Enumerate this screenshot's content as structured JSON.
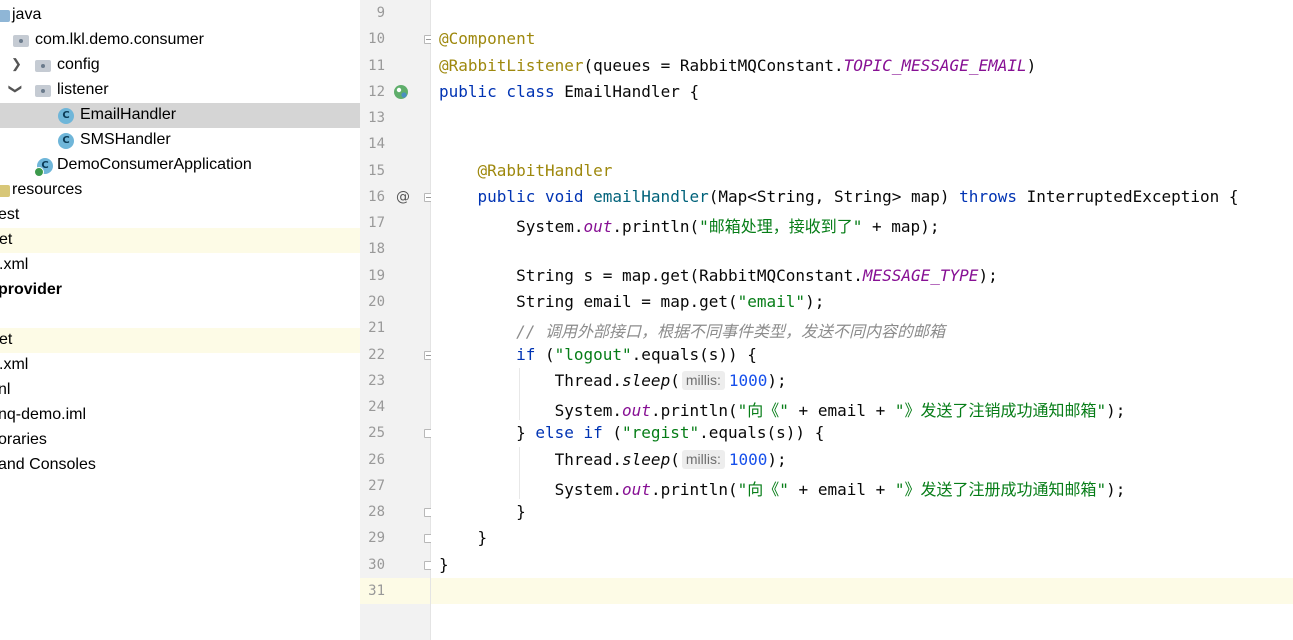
{
  "tree": {
    "items": [
      {
        "label": "java",
        "icon": "source-folder-icon"
      },
      {
        "label": "com.lkl.demo.consumer",
        "icon": "package-icon"
      },
      {
        "label": "config",
        "icon": "package-icon"
      },
      {
        "label": "listener",
        "icon": "package-icon"
      },
      {
        "label": "EmailHandler",
        "icon": "class-icon"
      },
      {
        "label": "SMSHandler",
        "icon": "class-icon"
      },
      {
        "label": "DemoConsumerApplication",
        "icon": "spring-app-icon"
      },
      {
        "label": "resources",
        "icon": "resources-folder-icon"
      },
      {
        "label": "est"
      },
      {
        "label": "et"
      },
      {
        "label": ".xml"
      },
      {
        "label": "provider"
      },
      {
        "label": ""
      },
      {
        "label": "et"
      },
      {
        "label": ".xml"
      },
      {
        "label": "nl"
      },
      {
        "label": "nq-demo.iml"
      },
      {
        "label": "oraries"
      },
      {
        "label": "and Consoles"
      }
    ],
    "class_icon_letter": "C"
  },
  "gutter": {
    "numbers": [
      "9",
      "10",
      "11",
      "12",
      "13",
      "14",
      "15",
      "16",
      "17",
      "18",
      "19",
      "20",
      "21",
      "22",
      "23",
      "24",
      "25",
      "26",
      "27",
      "28",
      "29",
      "30",
      "31"
    ],
    "override_marker": "@"
  },
  "code": {
    "lines": [
      {
        "parts": []
      },
      {
        "parts": [
          [
            "ann",
            "@Component"
          ]
        ]
      },
      {
        "parts": [
          [
            "ann",
            "@RabbitListener"
          ],
          [
            "",
            "(queues = RabbitMQConstant."
          ],
          [
            "stat",
            "TOPIC_MESSAGE_EMAIL"
          ],
          [
            "",
            ")"
          ]
        ]
      },
      {
        "parts": [
          [
            "kw",
            "public class "
          ],
          [
            "",
            "EmailHandler {"
          ]
        ]
      },
      {
        "parts": []
      },
      {
        "parts": []
      },
      {
        "parts": [
          [
            "",
            "    "
          ],
          [
            "ann",
            "@RabbitHandler"
          ]
        ]
      },
      {
        "parts": [
          [
            "",
            "    "
          ],
          [
            "kw",
            "public void "
          ],
          [
            "fn",
            "emailHandler"
          ],
          [
            "",
            "(Map<String, String> map) "
          ],
          [
            "kw",
            "throws "
          ],
          [
            "",
            "InterruptedException {"
          ]
        ]
      },
      {
        "parts": [
          [
            "",
            "        System."
          ],
          [
            "stat",
            "out"
          ],
          [
            "",
            ".println("
          ],
          [
            "str",
            "\"邮箱处理，接收到了\""
          ],
          [
            "",
            " + map);"
          ]
        ]
      },
      {
        "parts": []
      },
      {
        "parts": [
          [
            "",
            "        String s = map.get(RabbitMQConstant."
          ],
          [
            "stat",
            "MESSAGE_TYPE"
          ],
          [
            "",
            ");"
          ]
        ]
      },
      {
        "parts": [
          [
            "",
            "        String email = map.get("
          ],
          [
            "str",
            "\"email\""
          ],
          [
            "",
            ");"
          ]
        ]
      },
      {
        "parts": [
          [
            "",
            "        "
          ],
          [
            "cmt",
            "// 调用外部接口，根据不同事件类型，发送不同内容的邮箱"
          ]
        ]
      },
      {
        "parts": [
          [
            "",
            "        "
          ],
          [
            "kw",
            "if "
          ],
          [
            "",
            "("
          ],
          [
            "str",
            "\"logout\""
          ],
          [
            "",
            ".equals(s)) {"
          ]
        ]
      },
      {
        "parts": [
          [
            "",
            "            Thread."
          ],
          [
            "ital",
            "sleep"
          ],
          [
            "",
            "("
          ],
          [
            "hint",
            "millis:"
          ],
          [
            "num",
            "1000"
          ],
          [
            "",
            ");"
          ]
        ]
      },
      {
        "parts": [
          [
            "",
            "            System."
          ],
          [
            "stat",
            "out"
          ],
          [
            "",
            ".println("
          ],
          [
            "str",
            "\"向《\""
          ],
          [
            "",
            " + email + "
          ],
          [
            "str",
            "\"》发送了注销成功通知邮箱\""
          ],
          [
            "",
            ");"
          ]
        ]
      },
      {
        "parts": [
          [
            "",
            "        } "
          ],
          [
            "kw",
            "else if "
          ],
          [
            "",
            "("
          ],
          [
            "str",
            "\"regist\""
          ],
          [
            "",
            ".equals(s)) {"
          ]
        ]
      },
      {
        "parts": [
          [
            "",
            "            Thread."
          ],
          [
            "ital",
            "sleep"
          ],
          [
            "",
            "("
          ],
          [
            "hint",
            "millis:"
          ],
          [
            "num",
            "1000"
          ],
          [
            "",
            ");"
          ]
        ]
      },
      {
        "parts": [
          [
            "",
            "            System."
          ],
          [
            "stat",
            "out"
          ],
          [
            "",
            ".println("
          ],
          [
            "str",
            "\"向《\""
          ],
          [
            "",
            " + email + "
          ],
          [
            "str",
            "\"》发送了注册成功通知邮箱\""
          ],
          [
            "",
            ");"
          ]
        ]
      },
      {
        "parts": [
          [
            "",
            "        }"
          ]
        ]
      },
      {
        "parts": [
          [
            "",
            "    }"
          ]
        ]
      },
      {
        "parts": [
          [
            "",
            "}"
          ]
        ]
      },
      {
        "parts": []
      }
    ]
  }
}
